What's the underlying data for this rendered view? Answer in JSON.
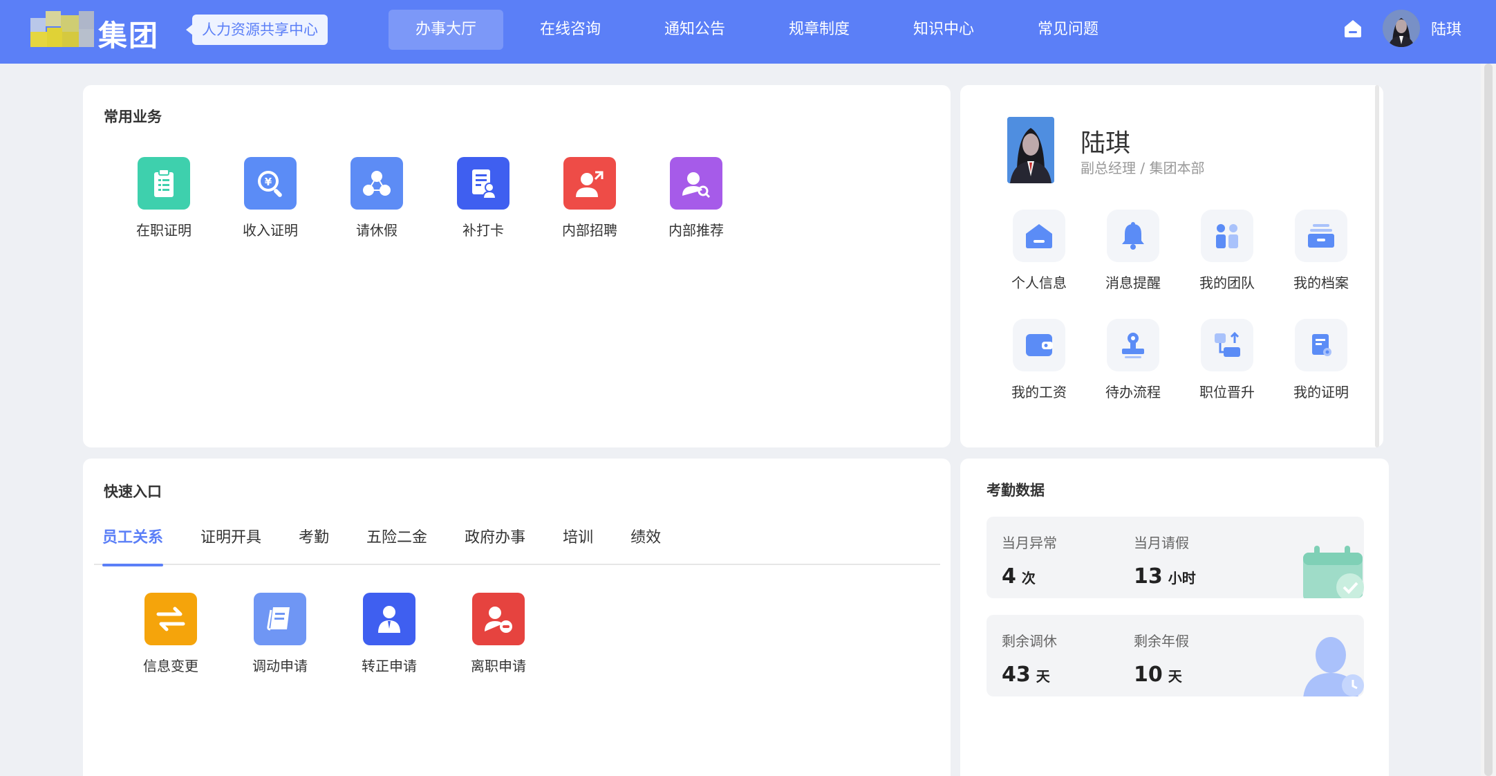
{
  "header": {
    "logo_text": "集团",
    "subsystem": "人力资源共享中心",
    "nav": [
      {
        "label": "办事大厅",
        "active": true
      },
      {
        "label": "在线咨询",
        "active": false
      },
      {
        "label": "通知公告",
        "active": false
      },
      {
        "label": "规章制度",
        "active": false
      },
      {
        "label": "知识中心",
        "active": false
      },
      {
        "label": "常见问题",
        "active": false
      }
    ],
    "user_name": "陆琪",
    "home_icon": "home-icon"
  },
  "common_business": {
    "title": "常用业务",
    "items": [
      {
        "label": "在职证明",
        "icon": "clipboard-icon",
        "color": "#3ed0ad"
      },
      {
        "label": "收入证明",
        "icon": "money-search-icon",
        "color": "#5b8cf6"
      },
      {
        "label": "请休假",
        "icon": "group-icon",
        "color": "#5d8cf5"
      },
      {
        "label": "补打卡",
        "icon": "document-user-icon",
        "color": "#3f5ff0"
      },
      {
        "label": "内部招聘",
        "icon": "user-arrow-icon",
        "color": "#ee4c47"
      },
      {
        "label": "内部推荐",
        "icon": "user-search-icon",
        "color": "#a65be9"
      }
    ]
  },
  "profile": {
    "name": "陆琪",
    "role": "副总经理 / 集团本部",
    "items": [
      {
        "label": "个人信息",
        "icon": "person-card-icon"
      },
      {
        "label": "消息提醒",
        "icon": "bell-icon"
      },
      {
        "label": "我的团队",
        "icon": "team-icon"
      },
      {
        "label": "我的档案",
        "icon": "archive-icon"
      },
      {
        "label": "我的工资",
        "icon": "wallet-icon"
      },
      {
        "label": "待办流程",
        "icon": "stamp-icon"
      },
      {
        "label": "职位晋升",
        "icon": "promotion-icon"
      },
      {
        "label": "我的证明",
        "icon": "certificate-icon"
      }
    ]
  },
  "quick_entry": {
    "title": "快速入口",
    "tabs": [
      {
        "label": "员工关系",
        "active": true
      },
      {
        "label": "证明开具",
        "active": false
      },
      {
        "label": "考勤",
        "active": false
      },
      {
        "label": "五险二金",
        "active": false
      },
      {
        "label": "政府办事",
        "active": false
      },
      {
        "label": "培训",
        "active": false
      },
      {
        "label": "绩效",
        "active": false
      }
    ],
    "items": [
      {
        "label": "信息变更",
        "icon": "swap-icon",
        "color": "#f5a40b"
      },
      {
        "label": "调动申请",
        "icon": "book-icon",
        "color": "#6f96f4"
      },
      {
        "label": "转正申请",
        "icon": "employee-icon",
        "color": "#3f5ff0"
      },
      {
        "label": "离职申请",
        "icon": "user-remove-icon",
        "color": "#e6433f"
      }
    ]
  },
  "attendance": {
    "title": "考勤数据",
    "blocks": [
      {
        "cells": [
          {
            "label": "当月异常",
            "value": "4",
            "unit": "次"
          },
          {
            "label": "当月请假",
            "value": "13",
            "unit": "小时"
          }
        ],
        "decoration": "calendar-check-icon"
      },
      {
        "cells": [
          {
            "label": "剩余调休",
            "value": "43",
            "unit": "天"
          },
          {
            "label": "剩余年假",
            "value": "10",
            "unit": "天"
          }
        ],
        "decoration": "person-clock-icon"
      }
    ]
  },
  "colors": {
    "brand": "#5b7ff7",
    "background": "#eef0f4"
  }
}
